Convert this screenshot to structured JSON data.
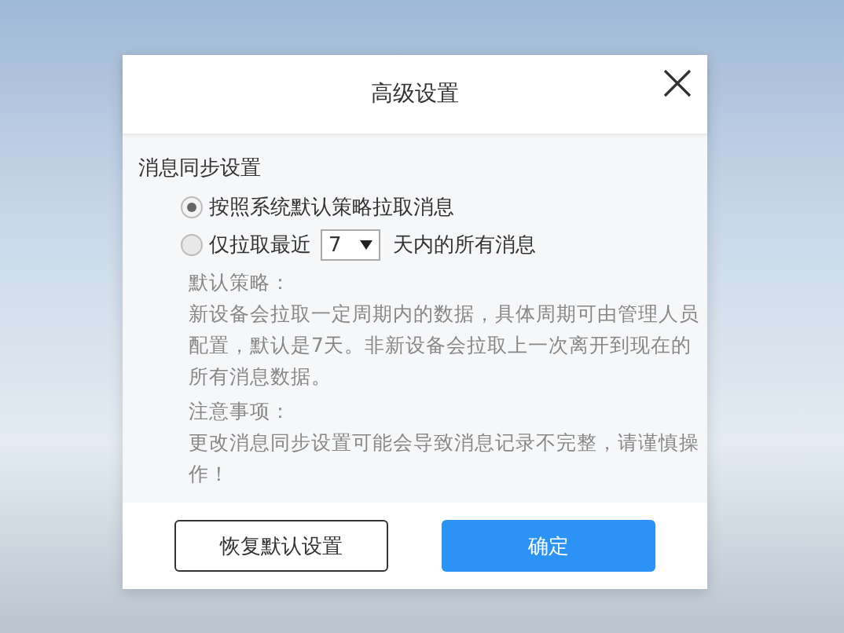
{
  "dialog": {
    "title": "高级设置",
    "section_title": "消息同步设置",
    "options": [
      {
        "label": "按照系统默认策略拉取消息",
        "selected": true
      },
      {
        "label": "仅拉取最近",
        "selected": false,
        "select_value": "7",
        "suffix": "天内的所有消息"
      }
    ],
    "notes": [
      {
        "heading": "默认策略：",
        "text": "新设备会拉取一定周期内的数据，具体周期可由管理人员配置，默认是7天。非新设备会拉取上一次离开到现在的所有消息数据。"
      },
      {
        "heading": "注意事项：",
        "text": "更改消息同步设置可能会导致消息记录不完整，请谨慎操作！"
      }
    ],
    "buttons": [
      {
        "label": "恢复默认设置",
        "kind": "secondary"
      },
      {
        "label": "确定",
        "kind": "primary"
      }
    ]
  }
}
